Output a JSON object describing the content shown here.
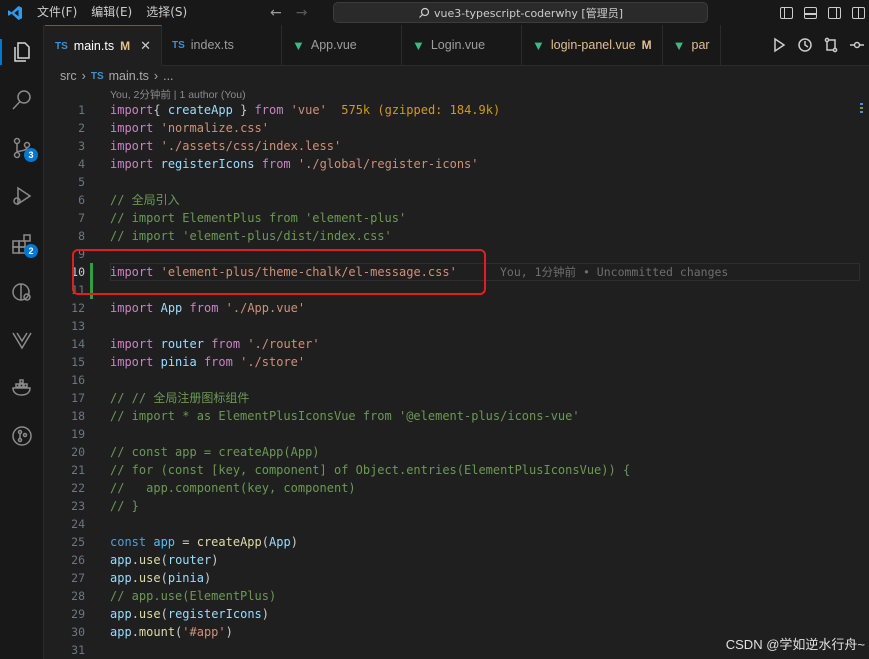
{
  "menu": [
    "文件(F)",
    "编辑(E)",
    "选择(S)"
  ],
  "command_center": "vue3-typescript-coderwhy [管理员]",
  "activity_badges": {
    "source_control": "3",
    "extensions": "2"
  },
  "tabs": [
    {
      "icon": "TS",
      "label": "main.ts",
      "status": "M",
      "active": true
    },
    {
      "icon": "TS",
      "label": "index.ts",
      "status": "",
      "active": false
    },
    {
      "icon": "vue",
      "label": "App.vue",
      "status": "",
      "active": false
    },
    {
      "icon": "vue",
      "label": "Login.vue",
      "status": "",
      "active": false
    },
    {
      "icon": "vue",
      "label": "login-panel.vue",
      "status": "M",
      "active": false
    },
    {
      "icon": "vue",
      "label": "par",
      "status": "",
      "active": false
    }
  ],
  "breadcrumb": {
    "folder": "src",
    "file_icon": "TS",
    "file": "main.ts",
    "more": "..."
  },
  "blame_header": "You, 2分钟前 | 1 author (You)",
  "inline_blame": "You, 1分钟前 • Uncommitted changes",
  "import_cost": "575k (gzipped: 184.9k)",
  "line_numbers": [
    "1",
    "2",
    "3",
    "4",
    "5",
    "6",
    "7",
    "8",
    "9",
    "10",
    "11",
    "12",
    "13",
    "14",
    "15",
    "16",
    "17",
    "18",
    "19",
    "20",
    "21",
    "22",
    "23",
    "24",
    "25",
    "26",
    "27",
    "28",
    "29",
    "30",
    "31"
  ],
  "code_lines": [
    [
      [
        "ck",
        "import"
      ],
      [
        "",
        "{ "
      ],
      [
        "var",
        "createApp"
      ],
      [
        "",
        " } "
      ],
      [
        "ck",
        "from"
      ],
      [
        "",
        " "
      ],
      [
        "str",
        "'vue'"
      ]
    ],
    [
      [
        "ck",
        "import"
      ],
      [
        "",
        " "
      ],
      [
        "str",
        "'normalize.css'"
      ]
    ],
    [
      [
        "ck",
        "import"
      ],
      [
        "",
        " "
      ],
      [
        "str",
        "'./assets/css/index.less'"
      ]
    ],
    [
      [
        "ck",
        "import"
      ],
      [
        "",
        " "
      ],
      [
        "var",
        "registerIcons"
      ],
      [
        "",
        " "
      ],
      [
        "ck",
        "from"
      ],
      [
        "",
        " "
      ],
      [
        "str",
        "'./global/register-icons'"
      ]
    ],
    [],
    [
      [
        "cm",
        "// 全局引入"
      ]
    ],
    [
      [
        "cm",
        "// import ElementPlus from 'element-plus'"
      ]
    ],
    [
      [
        "cm",
        "// import 'element-plus/dist/index.css'"
      ]
    ],
    [],
    [
      [
        "ck",
        "import"
      ],
      [
        "",
        " "
      ],
      [
        "str",
        "'element-plus/theme-chalk/el-message.css'"
      ]
    ],
    [],
    [
      [
        "ck",
        "import"
      ],
      [
        "",
        " "
      ],
      [
        "var",
        "App"
      ],
      [
        "",
        " "
      ],
      [
        "ck",
        "from"
      ],
      [
        "",
        " "
      ],
      [
        "str",
        "'./App.vue'"
      ]
    ],
    [],
    [
      [
        "ck",
        "import"
      ],
      [
        "",
        " "
      ],
      [
        "var",
        "router"
      ],
      [
        "",
        " "
      ],
      [
        "ck",
        "from"
      ],
      [
        "",
        " "
      ],
      [
        "str",
        "'./router'"
      ]
    ],
    [
      [
        "ck",
        "import"
      ],
      [
        "",
        " "
      ],
      [
        "var",
        "pinia"
      ],
      [
        "",
        " "
      ],
      [
        "ck",
        "from"
      ],
      [
        "",
        " "
      ],
      [
        "str",
        "'./store'"
      ]
    ],
    [],
    [
      [
        "cm",
        "// // 全局注册图标组件"
      ]
    ],
    [
      [
        "cm",
        "// import * as ElementPlusIconsVue from '@element-plus/icons-vue'"
      ]
    ],
    [],
    [
      [
        "cm",
        "// const app = createApp(App)"
      ]
    ],
    [
      [
        "cm",
        "// for (const [key, component] of Object.entries(ElementPlusIconsVue)) {"
      ]
    ],
    [
      [
        "cm",
        "//   app.component(key, component)"
      ]
    ],
    [
      [
        "cm",
        "// }"
      ]
    ],
    [],
    [
      [
        "kw",
        "const"
      ],
      [
        "",
        " "
      ],
      [
        "const",
        "app"
      ],
      [
        "",
        " = "
      ],
      [
        "fn",
        "createApp"
      ],
      [
        "",
        "("
      ],
      [
        "var",
        "App"
      ],
      [
        "",
        ")"
      ]
    ],
    [
      [
        "var",
        "app"
      ],
      [
        "",
        "."
      ],
      [
        "fn",
        "use"
      ],
      [
        "",
        "("
      ],
      [
        "var",
        "router"
      ],
      [
        "",
        ")"
      ]
    ],
    [
      [
        "var",
        "app"
      ],
      [
        "",
        "."
      ],
      [
        "fn",
        "use"
      ],
      [
        "",
        "("
      ],
      [
        "var",
        "pinia"
      ],
      [
        "",
        ")"
      ]
    ],
    [
      [
        "cm",
        "// app.use(ElementPlus)"
      ]
    ],
    [
      [
        "var",
        "app"
      ],
      [
        "",
        "."
      ],
      [
        "fn",
        "use"
      ],
      [
        "",
        "("
      ],
      [
        "var",
        "registerIcons"
      ],
      [
        "",
        ")"
      ]
    ],
    [
      [
        "var",
        "app"
      ],
      [
        "",
        "."
      ],
      [
        "fn",
        "mount"
      ],
      [
        "",
        "("
      ],
      [
        "str",
        "'#app'"
      ],
      [
        "",
        ")"
      ]
    ],
    []
  ],
  "watermark": "CSDN @学如逆水行舟~"
}
